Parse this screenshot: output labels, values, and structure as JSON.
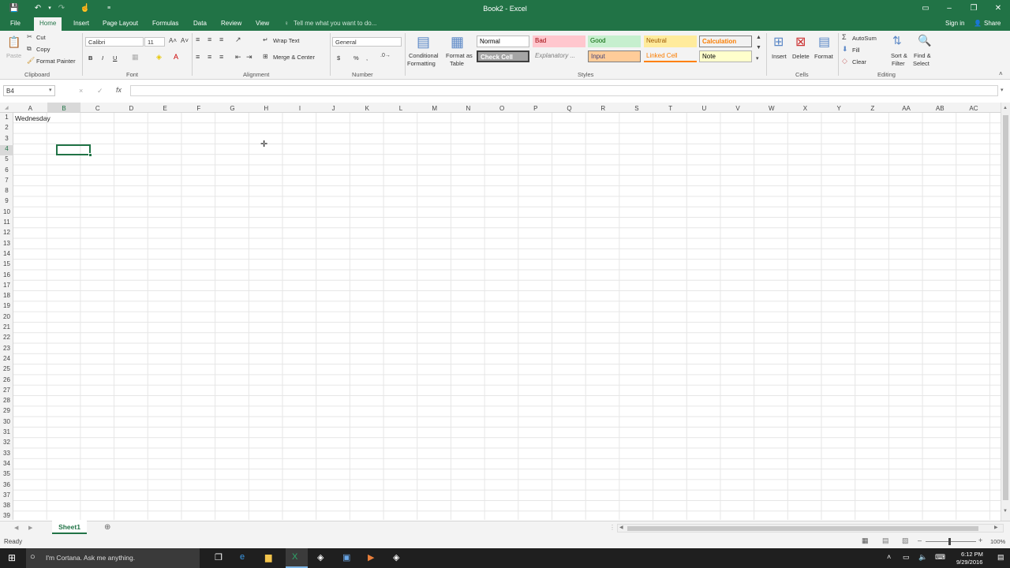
{
  "window": {
    "title": "Book2 - Excel"
  },
  "qat": {
    "undo": "undo",
    "redo": "redo",
    "touch": "touch-mode",
    "customize": "customize"
  },
  "tabs": {
    "file": "File",
    "home": "Home",
    "insert": "Insert",
    "page_layout": "Page Layout",
    "formulas": "Formulas",
    "data": "Data",
    "review": "Review",
    "view": "View",
    "tell_me": "Tell me what you want to do...",
    "sign_in": "Sign in",
    "share": "Share"
  },
  "clipboard": {
    "paste": "Paste",
    "cut": "Cut",
    "copy": "Copy",
    "format_painter": "Format Painter",
    "label": "Clipboard"
  },
  "font": {
    "name": "Calibri",
    "size": "11",
    "label": "Font",
    "bold": "B",
    "italic": "I",
    "underline": "U"
  },
  "alignment": {
    "wrap_text": "Wrap Text",
    "merge_center": "Merge & Center",
    "label": "Alignment"
  },
  "number": {
    "format": "General",
    "label": "Number",
    "currency": "$",
    "percent": "%",
    "comma": ","
  },
  "styles": {
    "conditional": [
      "Conditional",
      "Formatting"
    ],
    "format_table": [
      "Format as",
      "Table"
    ],
    "normal": "Normal",
    "bad": "Bad",
    "good": "Good",
    "neutral": "Neutral",
    "calculation": "Calculation",
    "check_cell": "Check Cell",
    "explanatory": "Explanatory ...",
    "input": "Input",
    "linked_cell": "Linked Cell",
    "note": "Note",
    "label": "Styles"
  },
  "cells": {
    "insert": "Insert",
    "delete": "Delete",
    "format": "Format",
    "label": "Cells"
  },
  "editing": {
    "autosum": "AutoSum",
    "fill": "Fill",
    "clear": "Clear",
    "sort": [
      "Sort &",
      "Filter"
    ],
    "find": [
      "Find &",
      "Select"
    ],
    "label": "Editing"
  },
  "formula_bar": {
    "name_box": "B4",
    "cancel": "×",
    "enter": "✓",
    "fx": "fx",
    "value": ""
  },
  "grid": {
    "columns": [
      "A",
      "B",
      "C",
      "D",
      "E",
      "F",
      "G",
      "H",
      "I",
      "J",
      "K",
      "L",
      "M",
      "N",
      "O",
      "P",
      "Q",
      "R",
      "S",
      "T",
      "U",
      "V",
      "W",
      "X",
      "Y",
      "Z",
      "AA",
      "AB",
      "AC"
    ],
    "rows": [
      "1",
      "2",
      "3",
      "4",
      "5",
      "6",
      "7",
      "8",
      "9",
      "10",
      "11",
      "12",
      "13",
      "14",
      "15",
      "16",
      "17",
      "18",
      "19",
      "20",
      "21",
      "22",
      "23",
      "24",
      "25",
      "26",
      "27",
      "28",
      "29",
      "30",
      "31",
      "32",
      "33",
      "34",
      "35",
      "36",
      "37",
      "38",
      "39"
    ],
    "a1": "Wednesday"
  },
  "sheets": {
    "active": "Sheet1"
  },
  "status": {
    "ready": "Ready",
    "zoom": "100%"
  },
  "taskbar": {
    "cortana": "I'm Cortana. Ask me anything.",
    "time": "6:12 PM",
    "date": "9/29/2016"
  }
}
